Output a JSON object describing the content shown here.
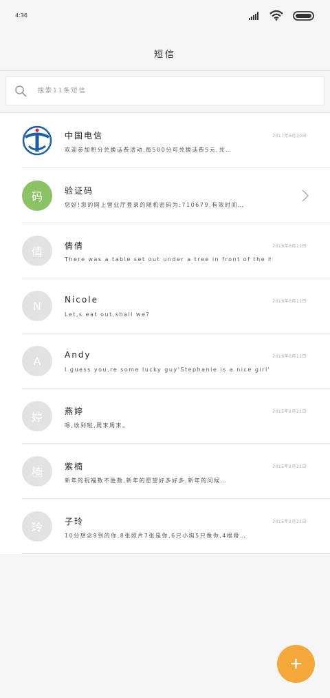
{
  "status_bar": {
    "time": "4:36",
    "icons": [
      "signal-icon",
      "wifi-icon",
      "battery-icon"
    ]
  },
  "header": {
    "title": "短信"
  },
  "search": {
    "placeholder": "搜索11条短信"
  },
  "conversations": [
    {
      "name": "中国电信",
      "preview": "欢迎参加积分兑换话费活动,每500分可兑换话费5元,兑…",
      "time": "2017年6月30日",
      "avatar_letter": "",
      "avatar_type": "logo"
    },
    {
      "name": "验证码",
      "preview": "您好!您的网上营业厅登录的随机密码为:710679,有效时间…",
      "time": "",
      "avatar_letter": "码",
      "avatar_type": "green",
      "has_chevron": true
    },
    {
      "name": "倩倩",
      "preview": "There was a table set out under a tree in front of the hous",
      "time": "2016年6月11日",
      "avatar_letter": "倩",
      "avatar_type": "gray"
    },
    {
      "name": "Nicole",
      "preview": "Let,s eat out,shall we?",
      "time": "2016年6月11日",
      "avatar_letter": "N",
      "avatar_type": "gray"
    },
    {
      "name": "Andy",
      "preview": "I guess you,re some lucky guy'Stephanie is a nice girl'",
      "time": "2016年6月11日",
      "avatar_letter": "A",
      "avatar_type": "gray"
    },
    {
      "name": "燕婷",
      "preview": "嗯,收到啦,周末周末。",
      "time": "2015年2月22日",
      "avatar_letter": "婷",
      "avatar_type": "gray"
    },
    {
      "name": "紫楠",
      "preview": "新年的祝福数不胜数,新年的愿望好多好多,新年的问候…",
      "time": "2015年2月22日",
      "avatar_letter": "楠",
      "avatar_type": "gray"
    },
    {
      "name": "子玲",
      "preview": "10分想念9到的你,8张照片7张是你,6只小狗5只像你,4根骨…",
      "time": "2015年2月22日",
      "avatar_letter": "玲",
      "avatar_type": "gray"
    }
  ],
  "fab": {
    "label": "+"
  },
  "colors": {
    "accent": "#f5a83a",
    "avatar_green": "#8cc266",
    "avatar_gray": "#e2e2e2",
    "telecom_blue": "#1a5fa8",
    "telecom_red": "#d9232d"
  }
}
